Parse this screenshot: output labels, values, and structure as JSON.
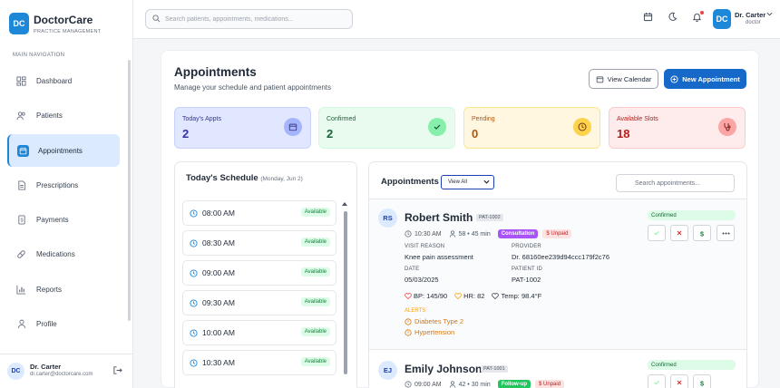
{
  "app": {
    "logo_initials": "DC",
    "name": "DoctorCare",
    "tagline": "PRACTICE MANAGEMENT"
  },
  "sidebar": {
    "section_label": "MAIN NAVIGATION",
    "items": [
      {
        "label": "Dashboard",
        "icon": "dashboard-icon"
      },
      {
        "label": "Patients",
        "icon": "users-icon"
      },
      {
        "label": "Appointments",
        "icon": "calendar-icon",
        "active": true
      },
      {
        "label": "Prescriptions",
        "icon": "document-icon"
      },
      {
        "label": "Payments",
        "icon": "receipt-icon"
      },
      {
        "label": "Medications",
        "icon": "pill-icon"
      },
      {
        "label": "Reports",
        "icon": "chart-icon"
      },
      {
        "label": "Profile",
        "icon": "user-icon"
      }
    ],
    "user": {
      "initials": "DC",
      "name": "Dr. Carter",
      "email": "dr.carter@doctorcare.com"
    }
  },
  "topbar": {
    "search_placeholder": "Search patients, appointments, medications...",
    "user": {
      "initials": "DC",
      "name": "Dr. Carter",
      "role": "doctor"
    }
  },
  "page": {
    "title": "Appointments",
    "subtitle": "Manage your schedule and patient appointments",
    "view_calendar_label": "View Calendar",
    "new_appointment_label": "New Appointment"
  },
  "stats": [
    {
      "label": "Today's Appts",
      "value": "2",
      "bg": "#e0e7ff",
      "border": "#c7d2fe",
      "fg": "#3730a3",
      "icon_bg": "#a5b4fc",
      "icon": "calendar-icon"
    },
    {
      "label": "Confirmed",
      "value": "2",
      "bg": "#e9fbef",
      "border": "#d1fadf",
      "fg": "#166534",
      "icon_bg": "#86efac",
      "icon": "check-icon"
    },
    {
      "label": "Pending",
      "value": "0",
      "bg": "#fff7e0",
      "border": "#fde68a",
      "fg": "#b45309",
      "icon_bg": "#fcd34d",
      "icon": "clock-icon"
    },
    {
      "label": "Available Slots",
      "value": "18",
      "bg": "#feecec",
      "border": "#fecaca",
      "fg": "#b91c1c",
      "icon_bg": "#fca5a5",
      "icon": "stethoscope-icon"
    }
  ],
  "schedule": {
    "title": "Today's Schedule",
    "date": "(Monday, Jun 2)",
    "slots": [
      {
        "time": "08:00 AM",
        "status": "Available"
      },
      {
        "time": "08:30 AM",
        "status": "Available"
      },
      {
        "time": "09:00 AM",
        "status": "Available"
      },
      {
        "time": "09:30 AM",
        "status": "Available"
      },
      {
        "time": "10:00 AM",
        "status": "Available"
      },
      {
        "time": "10:30 AM",
        "status": "Available"
      }
    ]
  },
  "appointments": {
    "title": "Appointments",
    "filter_value": "View All",
    "search_placeholder": "Search appointments...",
    "labels": {
      "reason": "VISIT REASON",
      "provider": "PROVIDER",
      "date": "DATE",
      "patient_id": "PATIENT ID",
      "alerts": "ALERTS"
    },
    "items": [
      {
        "initials": "RS",
        "name": "Robert Smith",
        "pat_id": "PAT-1002",
        "time": "10:30 AM",
        "duration": "58 • 45 min",
        "type": "Consultation",
        "payment": "$ Unpaid",
        "status": "Confirmed",
        "reason": "Knee pain assessment",
        "provider": "Dr. 68160ee239d94ccc179f2c76",
        "date": "05/03/2025",
        "patient_id": "PAT-1002",
        "bp": "BP: 145/90",
        "hr": "HR: 82",
        "temp": "Temp: 98.4°F",
        "alerts": [
          "Diabetes Type 2",
          "Hypertension"
        ]
      },
      {
        "initials": "EJ",
        "name": "Emily Johnson",
        "pat_id": "PAT-1001",
        "time": "09:00 AM",
        "duration": "42 • 30 min",
        "type": "Follow-up",
        "payment": "$ Unpaid",
        "status": "Confirmed"
      }
    ]
  }
}
